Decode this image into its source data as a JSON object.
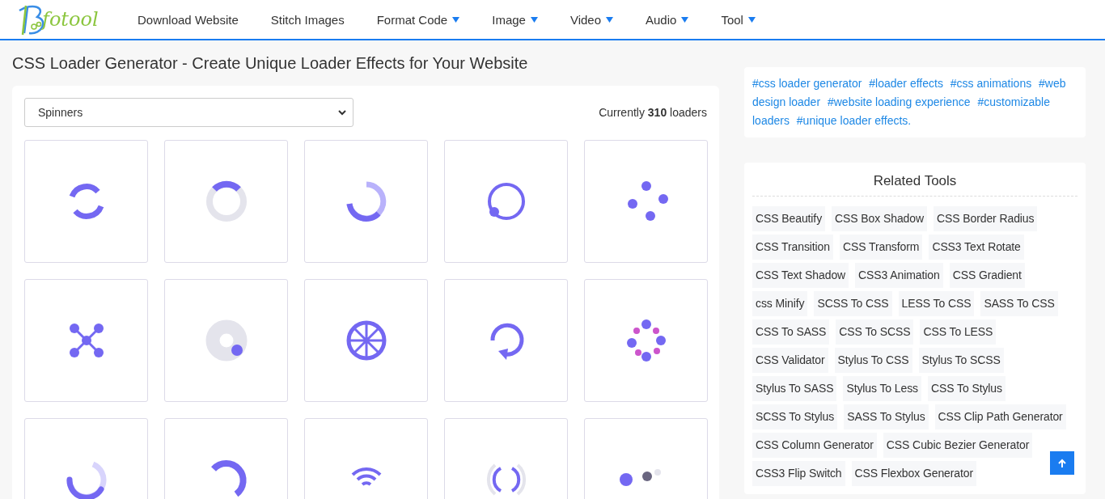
{
  "header": {
    "logo_text": "fotool",
    "nav": [
      {
        "label": "Download Website",
        "dropdown": false
      },
      {
        "label": "Stitch Images",
        "dropdown": false
      },
      {
        "label": "Format Code",
        "dropdown": true
      },
      {
        "label": "Image",
        "dropdown": true
      },
      {
        "label": "Video",
        "dropdown": true
      },
      {
        "label": "Audio",
        "dropdown": true
      },
      {
        "label": "Tool",
        "dropdown": true
      }
    ]
  },
  "page_title": "CSS Loader Generator - Create Unique Loader Effects for Your Website",
  "category_select": {
    "value": "Spinners"
  },
  "loader_count": "Currently **310** loaders",
  "loaders": [
    {
      "kind": "split-arc"
    },
    {
      "kind": "ring-arc"
    },
    {
      "kind": "fade-arc"
    },
    {
      "kind": "orbit-dot"
    },
    {
      "kind": "four-dots"
    },
    {
      "kind": "cross-nodes"
    },
    {
      "kind": "donut-dot"
    },
    {
      "kind": "wheel"
    },
    {
      "kind": "refresh"
    },
    {
      "kind": "dot-ring"
    },
    {
      "kind": "tail-arc"
    },
    {
      "kind": "thick-arc"
    },
    {
      "kind": "wifi"
    },
    {
      "kind": "signal"
    },
    {
      "kind": "bounce-dots"
    }
  ],
  "tags": [
    "#css loader generator",
    "#loader effects",
    "#css animations",
    "#web design loader",
    "#website loading experience",
    "#customizable loaders",
    "#unique loader effects."
  ],
  "related_tools": {
    "title": "Related Tools",
    "items": [
      "CSS Beautify",
      "CSS Box Shadow",
      "CSS Border Radius",
      "CSS Transition",
      "CSS Transform",
      "CSS3 Text Rotate",
      "CSS Text Shadow",
      "CSS3 Animation",
      "CSS Gradient",
      "css Minify",
      "SCSS To CSS",
      "LESS To CSS",
      "SASS To CSS",
      "CSS To SASS",
      "CSS To SCSS",
      "CSS To LESS",
      "CSS Validator",
      "Stylus To CSS",
      "Stylus To SCSS",
      "Stylus To SASS",
      "Stylus To Less",
      "CSS To Stylus",
      "SCSS To Stylus",
      "SASS To Stylus",
      "CSS Clip Path Generator",
      "CSS Column Generator",
      "CSS Cubic Bezier Generator",
      "CSS3 Flip Switch",
      "CSS Flexbox Generator"
    ]
  }
}
